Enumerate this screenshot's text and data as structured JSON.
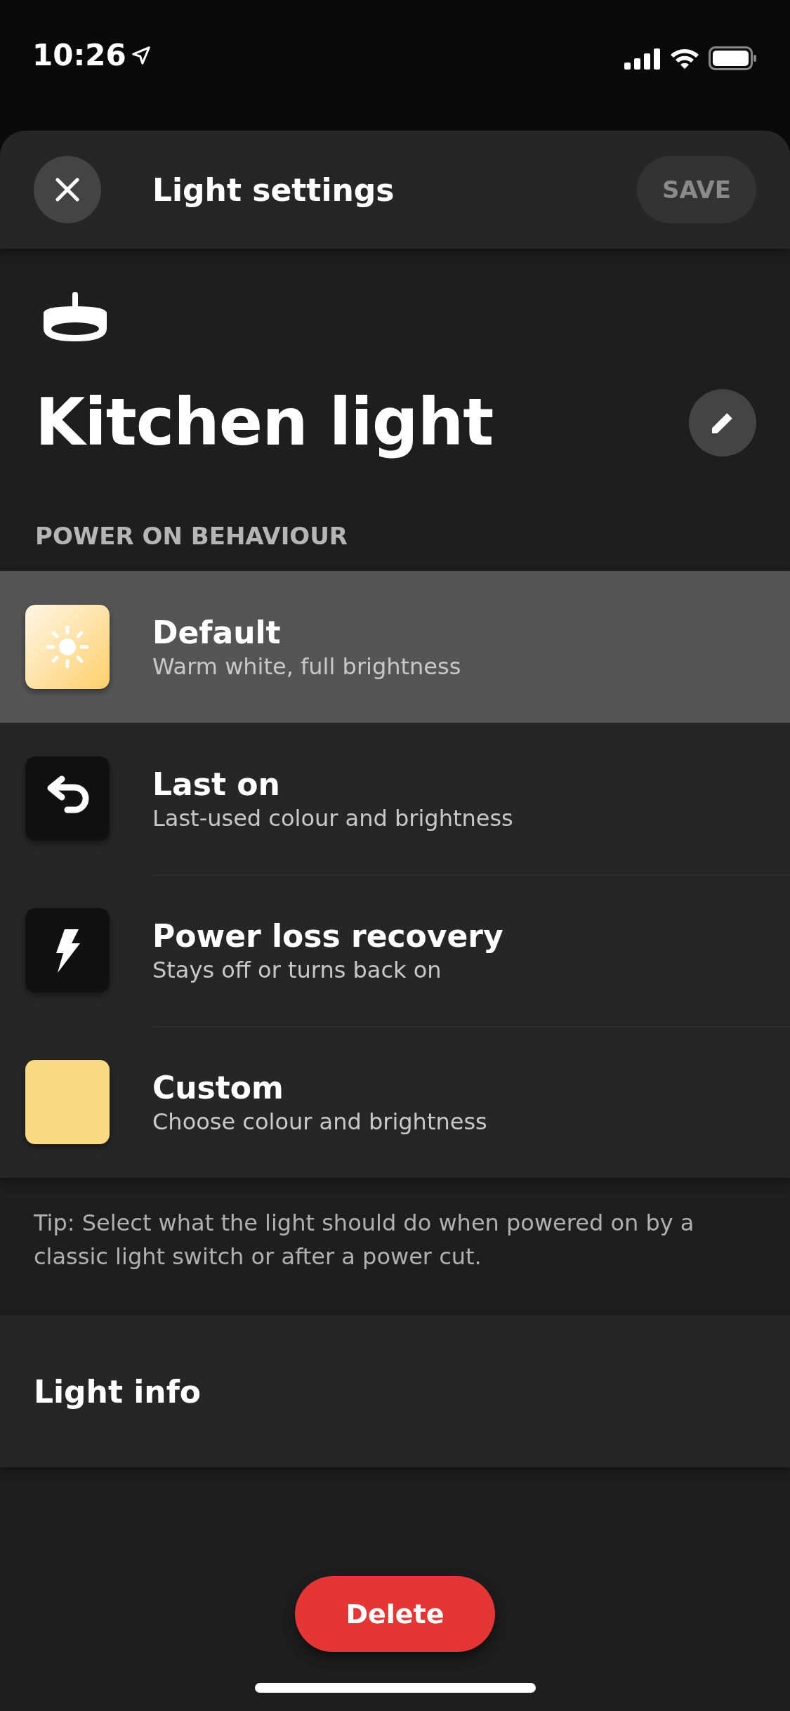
{
  "status_bar": {
    "time": "10:26"
  },
  "header": {
    "title": "Light settings",
    "save": {
      "label": "SAVE",
      "disabled": true
    }
  },
  "light": {
    "name": "Kitchen light"
  },
  "section": {
    "title": "POWER ON BEHAVIOUR",
    "options": [
      {
        "kind": "sun",
        "title": "Default",
        "subtitle": "Warm white, full brightness",
        "selected": true
      },
      {
        "kind": "undo",
        "title": "Last on",
        "subtitle": "Last-used colour and brightness",
        "selected": false
      },
      {
        "kind": "bolt",
        "title": "Power loss recovery",
        "subtitle": "Stays off or turns back on",
        "selected": false
      },
      {
        "kind": "swatch",
        "title": "Custom",
        "subtitle": "Choose colour and brightness",
        "selected": false
      }
    ],
    "tip": "Tip: Select what the light should do when powered on by a classic light switch or after a power cut."
  },
  "info": {
    "label": "Light info"
  },
  "delete": {
    "label": "Delete"
  }
}
